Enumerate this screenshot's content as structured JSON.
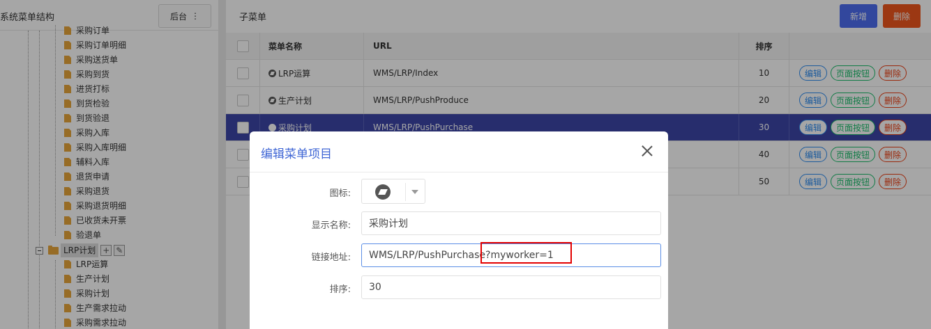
{
  "left_panel": {
    "title": "系统菜单结构",
    "backend_button": "后台",
    "backend_menu_glyph": "⋮",
    "tree_items": [
      "采购订单",
      "采购订单明细",
      "采购送货单",
      "采购到货",
      "进货打标",
      "到货检验",
      "到货验退",
      "采购入库",
      "采购入库明细",
      "辅料入库",
      "退货申请",
      "采购退货",
      "采购退货明细",
      "已收货未开票",
      "验退单"
    ],
    "folder_node": {
      "label": "LRP计划",
      "add_glyph": "+",
      "edit_glyph": "✎"
    },
    "child_items": [
      "LRP运算",
      "生产计划",
      "采购计划",
      "生产需求拉动",
      "采购需求拉动"
    ]
  },
  "right_panel": {
    "title": "子菜单",
    "add_button": "新增",
    "delete_button": "删除",
    "columns": {
      "name": "菜单名称",
      "url": "URL",
      "sort": "排序"
    },
    "rows": [
      {
        "name": "LRP运算",
        "url": "WMS/LRP/Index",
        "sort": "10"
      },
      {
        "name": "生产计划",
        "url": "WMS/LRP/PushProduce",
        "sort": "20"
      },
      {
        "name": "采购计划",
        "url": "WMS/LRP/PushPurchase",
        "sort": "30"
      },
      {
        "name": "",
        "url": "",
        "sort": "40"
      },
      {
        "name": "",
        "url": "",
        "sort": "50"
      }
    ],
    "row_actions": {
      "edit": "编辑",
      "page_buttons": "页面按钮",
      "delete": "删除"
    }
  },
  "dialog": {
    "title": "编辑菜单项目",
    "icon_label": "图标:",
    "name_label": "显示名称:",
    "name_value": "采购计划",
    "url_label": "链接地址:",
    "url_value": "WMS/LRP/PushPurchase?myworker=1",
    "sort_label": "排序:",
    "sort_value": "30"
  },
  "colors": {
    "primary": "#4e6ef2",
    "danger": "#f0561e",
    "selected_row": "#3c46a8",
    "highlight": "#e30000",
    "folder": "#e9a73b"
  }
}
